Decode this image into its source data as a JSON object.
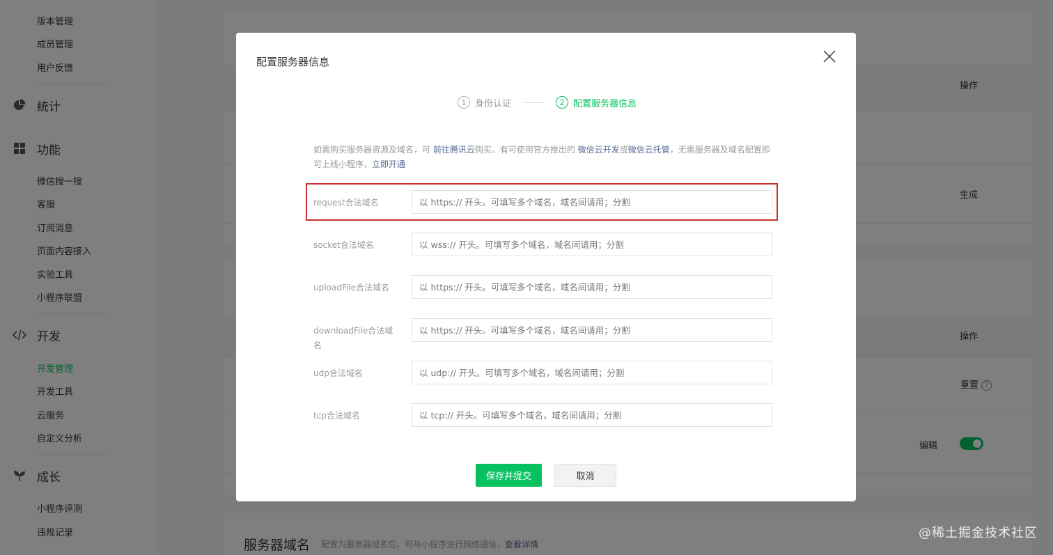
{
  "sidebar": {
    "top_items": [
      "版本管理",
      "成员管理",
      "用户反馈"
    ],
    "group_stats": "统计",
    "group_features": "功能",
    "feature_items": [
      "微信搜一搜",
      "客服",
      "订阅消息",
      "页面内容接入",
      "实验工具",
      "小程序联盟"
    ],
    "group_dev": "开发",
    "dev_items": [
      "开发管理",
      "开发工具",
      "云服务",
      "自定义分析"
    ],
    "group_growth": "成长",
    "growth_items": [
      "小程序评测",
      "违规记录"
    ],
    "active_item": "开发管理"
  },
  "background": {
    "col_op_1": "操作",
    "action_generate": "生成",
    "col_op_2": "操作",
    "action_reset": "重置",
    "action_edit": "编辑",
    "toggle_on": true,
    "section_title": "服务器域名",
    "section_desc": "配置为服务器域名后，可与小程序进行网络通信，",
    "section_link": "查看详情"
  },
  "dialog": {
    "title": "配置服务器信息",
    "steps": [
      {
        "num": "1",
        "label": "身份认证",
        "state": "done"
      },
      {
        "num": "2",
        "label": "配置服务器信息",
        "state": "current"
      }
    ],
    "desc": {
      "p1": "如需购买服务器资源及域名，可 ",
      "link1": "前往腾讯云",
      "p2": "购买。有可使用官方推出的 ",
      "link2": "微信云开发",
      "p3": "或",
      "link3": "微信云托管",
      "p4": "，无需服务器及域名配置即可上线小程序，",
      "link4": "立即开通"
    },
    "fields": [
      {
        "label": "request合法域名",
        "placeholder": "以 https:// 开头。可填写多个域名，域名间请用；分割",
        "value": ""
      },
      {
        "label": "socket合法域名",
        "placeholder": "以 wss:// 开头。可填写多个域名，域名间请用；分割",
        "value": ""
      },
      {
        "label": "uploadFile合法域名",
        "placeholder": "以 https:// 开头。可填写多个域名，域名间请用；分割",
        "value": ""
      },
      {
        "label": "downloadFile合法域名",
        "placeholder": "以 https:// 开头。可填写多个域名，域名间请用；分割",
        "value": ""
      },
      {
        "label": "udp合法域名",
        "placeholder": "以 udp:// 开头。可填写多个域名，域名间请用；分割",
        "value": ""
      },
      {
        "label": "tcp合法域名",
        "placeholder": "以 tcp:// 开头。可填写多个域名，域名间请用；分割",
        "value": ""
      }
    ],
    "submit_label": "保存并提交",
    "cancel_label": "取消"
  },
  "watermark": "@稀土掘金技术社区",
  "colors": {
    "accent": "#07c160",
    "link": "#576b95",
    "highlight": "#c9302c",
    "overlay": "rgba(0,0,0,0.5)"
  },
  "icons": [
    "pie-chart-icon",
    "grid-icon",
    "code-icon",
    "sprout-icon",
    "close-icon",
    "help-icon"
  ]
}
